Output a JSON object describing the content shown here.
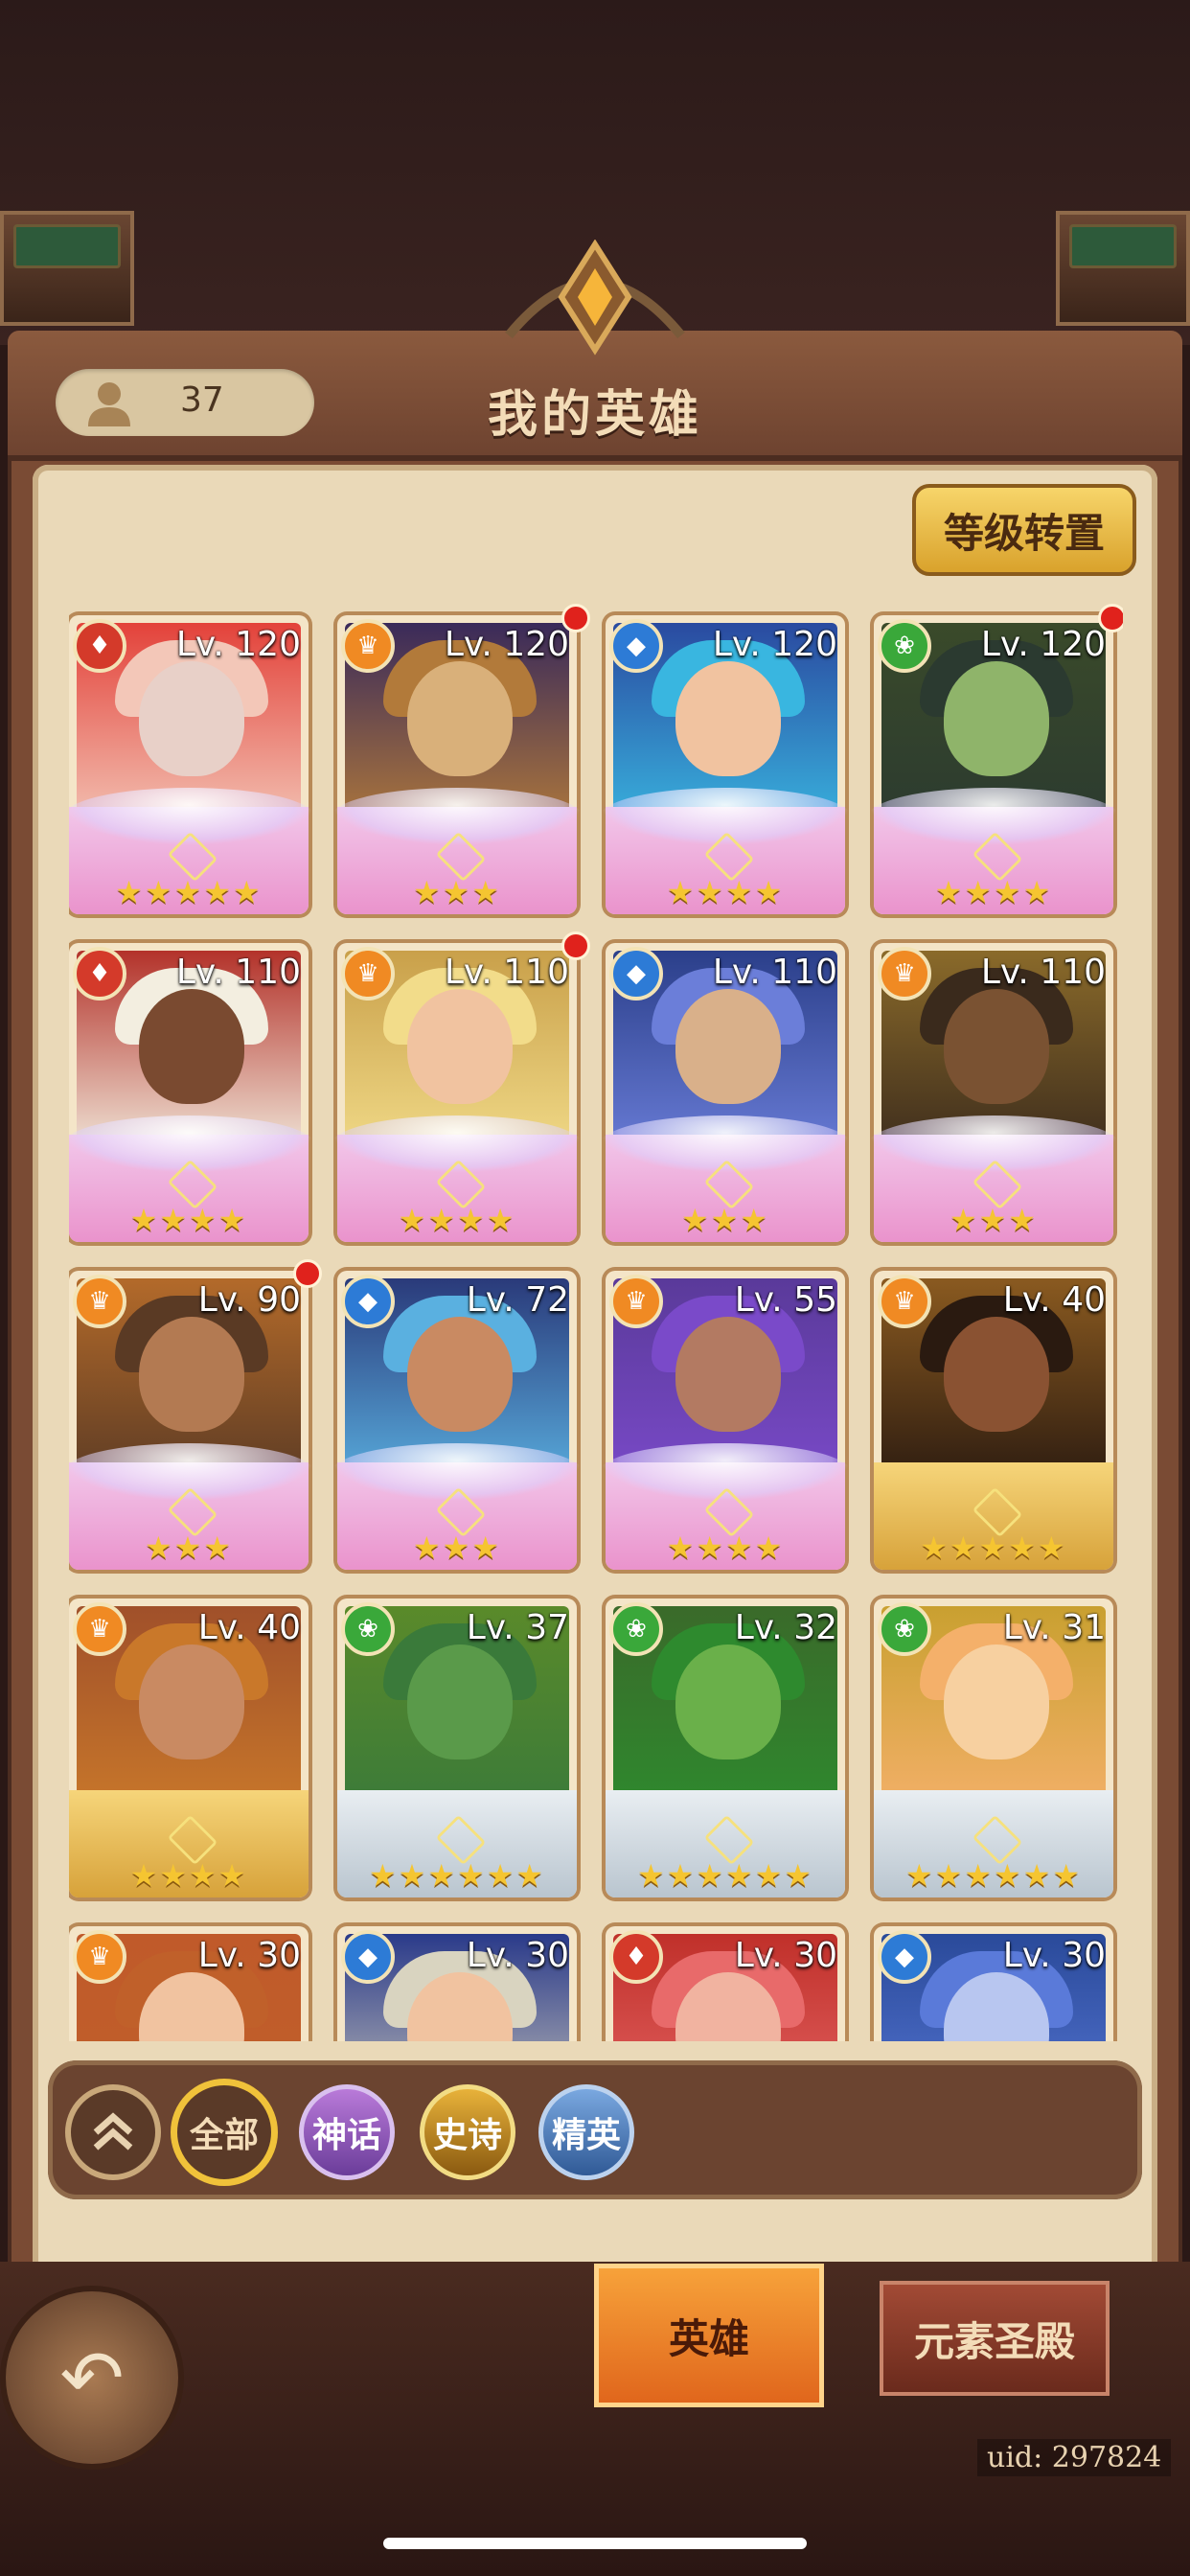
{
  "header": {
    "title": "我的英雄"
  },
  "hero_count": "37",
  "rank_button_label": "等级转置",
  "heroes": [
    {
      "level": "Lv. 120",
      "element": "fire",
      "stars": "★★★★★",
      "notify": false,
      "rarity": "pink"
    },
    {
      "level": "Lv. 120",
      "element": "light",
      "stars": "★★★",
      "notify": true,
      "rarity": "pink"
    },
    {
      "level": "Lv. 120",
      "element": "water",
      "stars": "★★★★",
      "notify": false,
      "rarity": "pink"
    },
    {
      "level": "Lv. 120",
      "element": "nature",
      "stars": "★★★★",
      "notify": true,
      "rarity": "pink"
    },
    {
      "level": "Lv. 110",
      "element": "fire",
      "stars": "★★★★",
      "notify": false,
      "rarity": "pink"
    },
    {
      "level": "Lv. 110",
      "element": "light",
      "stars": "★★★★",
      "notify": true,
      "rarity": "pink"
    },
    {
      "level": "Lv. 110",
      "element": "water",
      "stars": "★★★",
      "notify": false,
      "rarity": "pink"
    },
    {
      "level": "Lv. 110",
      "element": "light",
      "stars": "★★★",
      "notify": false,
      "rarity": "pink"
    },
    {
      "level": "Lv. 90",
      "element": "light",
      "stars": "★★★",
      "notify": true,
      "rarity": "pink"
    },
    {
      "level": "Lv. 72",
      "element": "water",
      "stars": "★★★",
      "notify": false,
      "rarity": "pink"
    },
    {
      "level": "Lv. 55",
      "element": "light",
      "stars": "★★★★",
      "notify": false,
      "rarity": "pink"
    },
    {
      "level": "Lv. 40",
      "element": "light",
      "stars": "★★★★★",
      "notify": false,
      "rarity": "gold"
    },
    {
      "level": "Lv. 40",
      "element": "light",
      "stars": "★★★★",
      "notify": false,
      "rarity": "gold"
    },
    {
      "level": "Lv. 37",
      "element": "nature",
      "stars": "★★★★★★",
      "notify": false,
      "rarity": "silver"
    },
    {
      "level": "Lv. 32",
      "element": "nature",
      "stars": "★★★★★★",
      "notify": false,
      "rarity": "silver"
    },
    {
      "level": "Lv. 31",
      "element": "nature",
      "stars": "★★★★★★",
      "notify": false,
      "rarity": "silver"
    },
    {
      "level": "Lv. 30",
      "element": "light",
      "stars": "",
      "notify": false,
      "rarity": "pink"
    },
    {
      "level": "Lv. 30",
      "element": "water",
      "stars": "",
      "notify": false,
      "rarity": "pink"
    },
    {
      "level": "Lv. 30",
      "element": "fire",
      "stars": "",
      "notify": false,
      "rarity": "pink"
    },
    {
      "level": "Lv. 30",
      "element": "water",
      "stars": "",
      "notify": false,
      "rarity": "pink"
    }
  ],
  "filters": {
    "all": "全部",
    "myth": "神话",
    "epic": "史诗",
    "elite": "精英"
  },
  "tabs": {
    "hero": "英雄",
    "temple": "元素圣殿"
  },
  "uid": "uid: 297824",
  "colors": {
    "fire": "#d43a2a",
    "light": "#f08a23",
    "water": "#2d7bd6",
    "nature": "#3aa83a",
    "accent": "#f0c23a"
  },
  "icons": {
    "collapse": "chevron-double-up-icon",
    "back": "back-arrow-icon",
    "hero_count": "person-icon"
  }
}
